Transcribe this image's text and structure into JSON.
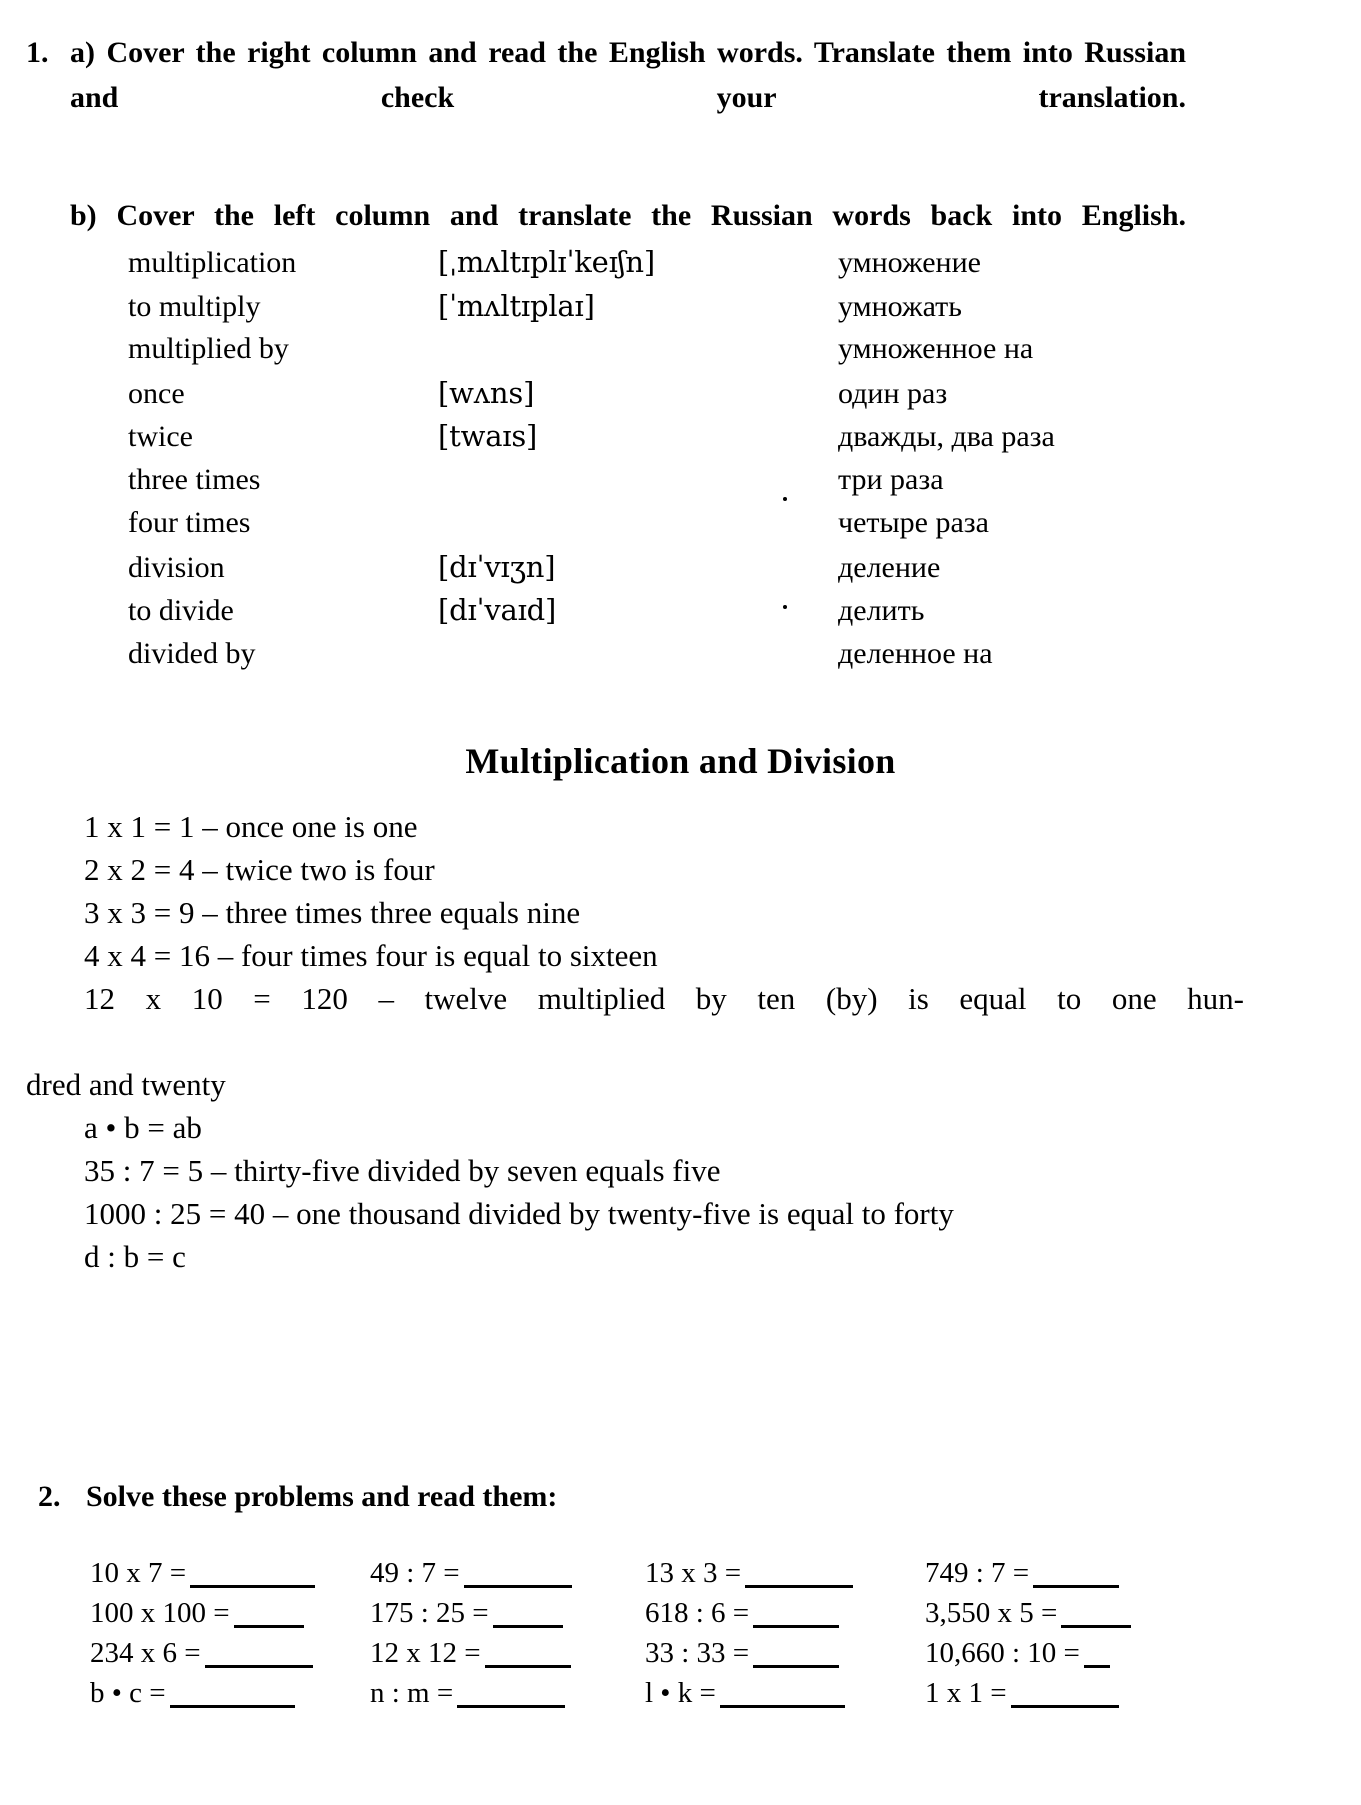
{
  "exercise1": {
    "number": "1.",
    "part_a_label": "a)",
    "part_a_text": "a) Cover the right column and read the English words. Translate them into Russian and check your translation.",
    "part_b_text": "b) Cover the left column and translate the Russian words back into English."
  },
  "vocabulary": {
    "rows": [
      {
        "english": "multiplication",
        "ipa": "[ˌmʌltɪplɪˈkeɪʃn]",
        "russian": "умножение"
      },
      {
        "english": "to multiply",
        "ipa": "[ˈmʌltɪplaɪ]",
        "russian": "умножать"
      },
      {
        "english": "multiplied by",
        "ipa": "",
        "russian": "умноженное на"
      },
      {
        "english": "once",
        "ipa": "[wʌns]",
        "russian": "один раз"
      },
      {
        "english": "twice",
        "ipa": "[twaɪs]",
        "russian": "дважды, два раза"
      },
      {
        "english": "three times",
        "ipa": "",
        "russian": "три раза"
      },
      {
        "english": "four times",
        "ipa": "",
        "russian": "четыре раза"
      },
      {
        "english": "division",
        "ipa": "[dɪˈvɪʒn]",
        "russian": "деление"
      },
      {
        "english": "to divide",
        "ipa": "[dɪˈvaɪd]",
        "russian": "делить"
      },
      {
        "english": "divided by",
        "ipa": "",
        "russian": "деленное на"
      }
    ]
  },
  "section": {
    "title": "Multiplication and Division",
    "examples": [
      "1 x 1 = 1 – once one is one",
      "2 x 2 = 4 – twice two is four",
      "3 x 3 = 9 – three times three equals nine",
      "4 x 4 = 16 – four times four is equal to sixteen",
      "12 x 10 = 120 – twelve multiplied by ten (by) is equal to one hun-dred and twenty",
      "a • b = ab",
      "35 : 7 = 5 – thirty-five divided by seven equals five",
      "1000 : 25 = 40 – one thousand divided by twenty-five is equal to forty",
      "d : b = c"
    ],
    "example_12x10_part1": "12 x 10 = 120 – twelve multiplied by ten (by) is equal to one hun-",
    "example_12x10_part2": "dred and twenty"
  },
  "exercise2": {
    "number": "2.",
    "text": "Solve these problems and read them:",
    "columns": [
      {
        "problems": [
          "10 x 7 =",
          "100 x 100 =",
          "234 x 6 =",
          "b • c ="
        ]
      },
      {
        "problems": [
          "49 : 7 =",
          "175 : 25 =",
          "12 x 12 =",
          "n : m ="
        ]
      },
      {
        "problems": [
          "13 x 3 =",
          "618 : 6 =",
          "33 : 33 =",
          "l • k ="
        ]
      },
      {
        "problems": [
          "749 : 7 =",
          "3,550 x 5 =",
          "10,660 : 10 =",
          "1 x 1 ="
        ]
      }
    ]
  },
  "colors": {
    "ink": "#000000",
    "paper": "#ffffff"
  }
}
